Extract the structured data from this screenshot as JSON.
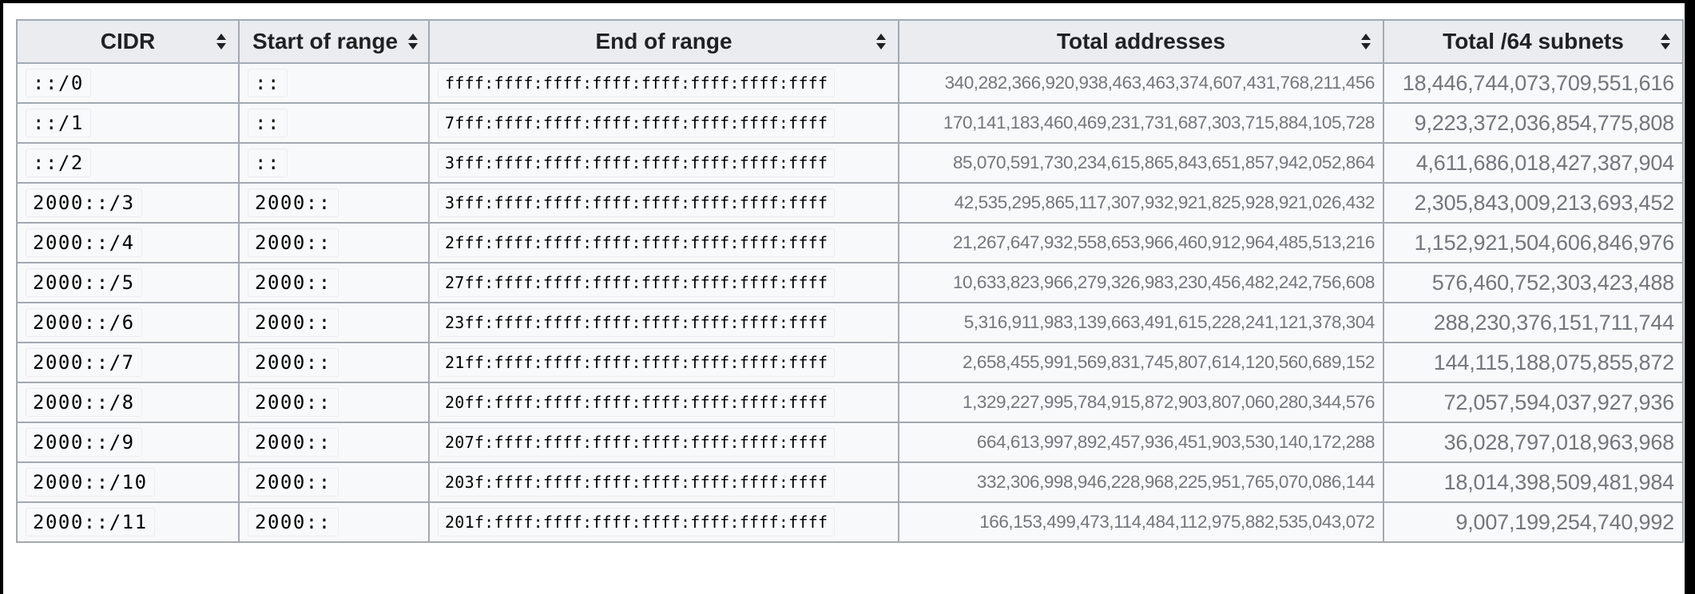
{
  "table": {
    "headers": [
      {
        "label": "CIDR",
        "sortable": true,
        "sort_icon": "sort-both-icon"
      },
      {
        "label": "Start of range",
        "sortable": true,
        "sort_icon": "sort-both-icon"
      },
      {
        "label": "End of range",
        "sortable": true,
        "sort_icon": "sort-both-icon"
      },
      {
        "label": "Total addresses",
        "sortable": true,
        "sort_icon": "sort-both-icon"
      },
      {
        "label": "Total /64 subnets",
        "sortable": true,
        "sort_icon": "sort-both-icon"
      }
    ],
    "rows": [
      {
        "cidr": "::/0",
        "start": "::",
        "end": "ffff:ffff:ffff:ffff:ffff:ffff:ffff:ffff",
        "total_addresses": "340,282,366,920,938,463,463,374,607,431,768,211,456",
        "total_64_subnets": "18,446,744,073,709,551,616"
      },
      {
        "cidr": "::/1",
        "start": "::",
        "end": "7fff:ffff:ffff:ffff:ffff:ffff:ffff:ffff",
        "total_addresses": "170,141,183,460,469,231,731,687,303,715,884,105,728",
        "total_64_subnets": "9,223,372,036,854,775,808"
      },
      {
        "cidr": "::/2",
        "start": "::",
        "end": "3fff:ffff:ffff:ffff:ffff:ffff:ffff:ffff",
        "total_addresses": "85,070,591,730,234,615,865,843,651,857,942,052,864",
        "total_64_subnets": "4,611,686,018,427,387,904"
      },
      {
        "cidr": "2000::/3",
        "start": "2000::",
        "end": "3fff:ffff:ffff:ffff:ffff:ffff:ffff:ffff",
        "total_addresses": "42,535,295,865,117,307,932,921,825,928,921,026,432",
        "total_64_subnets": "2,305,843,009,213,693,452"
      },
      {
        "cidr": "2000::/4",
        "start": "2000::",
        "end": "2fff:ffff:ffff:ffff:ffff:ffff:ffff:ffff",
        "total_addresses": "21,267,647,932,558,653,966,460,912,964,485,513,216",
        "total_64_subnets": "1,152,921,504,606,846,976"
      },
      {
        "cidr": "2000::/5",
        "start": "2000::",
        "end": "27ff:ffff:ffff:ffff:ffff:ffff:ffff:ffff",
        "total_addresses": "10,633,823,966,279,326,983,230,456,482,242,756,608",
        "total_64_subnets": "576,460,752,303,423,488"
      },
      {
        "cidr": "2000::/6",
        "start": "2000::",
        "end": "23ff:ffff:ffff:ffff:ffff:ffff:ffff:ffff",
        "total_addresses": "5,316,911,983,139,663,491,615,228,241,121,378,304",
        "total_64_subnets": "288,230,376,151,711,744"
      },
      {
        "cidr": "2000::/7",
        "start": "2000::",
        "end": "21ff:ffff:ffff:ffff:ffff:ffff:ffff:ffff",
        "total_addresses": "2,658,455,991,569,831,745,807,614,120,560,689,152",
        "total_64_subnets": "144,115,188,075,855,872"
      },
      {
        "cidr": "2000::/8",
        "start": "2000::",
        "end": "20ff:ffff:ffff:ffff:ffff:ffff:ffff:ffff",
        "total_addresses": "1,329,227,995,784,915,872,903,807,060,280,344,576",
        "total_64_subnets": "72,057,594,037,927,936"
      },
      {
        "cidr": "2000::/9",
        "start": "2000::",
        "end": "207f:ffff:ffff:ffff:ffff:ffff:ffff:ffff",
        "total_addresses": "664,613,997,892,457,936,451,903,530,140,172,288",
        "total_64_subnets": "36,028,797,018,963,968"
      },
      {
        "cidr": "2000::/10",
        "start": "2000::",
        "end": "203f:ffff:ffff:ffff:ffff:ffff:ffff:ffff",
        "total_addresses": "332,306,998,946,228,968,225,951,765,070,086,144",
        "total_64_subnets": "18,014,398,509,481,984"
      },
      {
        "cidr": "2000::/11",
        "start": "2000::",
        "end": "201f:ffff:ffff:ffff:ffff:ffff:ffff:ffff",
        "total_addresses": "166,153,499,473,114,484,112,975,882,535,043,072",
        "total_64_subnets": "9,007,199,254,740,992"
      }
    ]
  }
}
